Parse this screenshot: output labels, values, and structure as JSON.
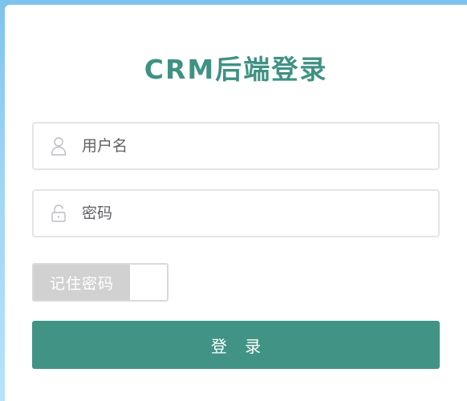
{
  "header": {
    "title": "CRM后端登录"
  },
  "form": {
    "username_placeholder": "用户名",
    "username_value": "",
    "password_placeholder": "密码",
    "password_value": "",
    "remember_label": "记住密码",
    "remember_checked": false,
    "login_label": "登 录"
  },
  "icons": {
    "username": "user-icon",
    "password": "lock-icon"
  },
  "colors": {
    "accent": "#3f9283",
    "button": "#419485",
    "toggle_off": "#d1d1d1",
    "background": "#9fd6f7"
  }
}
